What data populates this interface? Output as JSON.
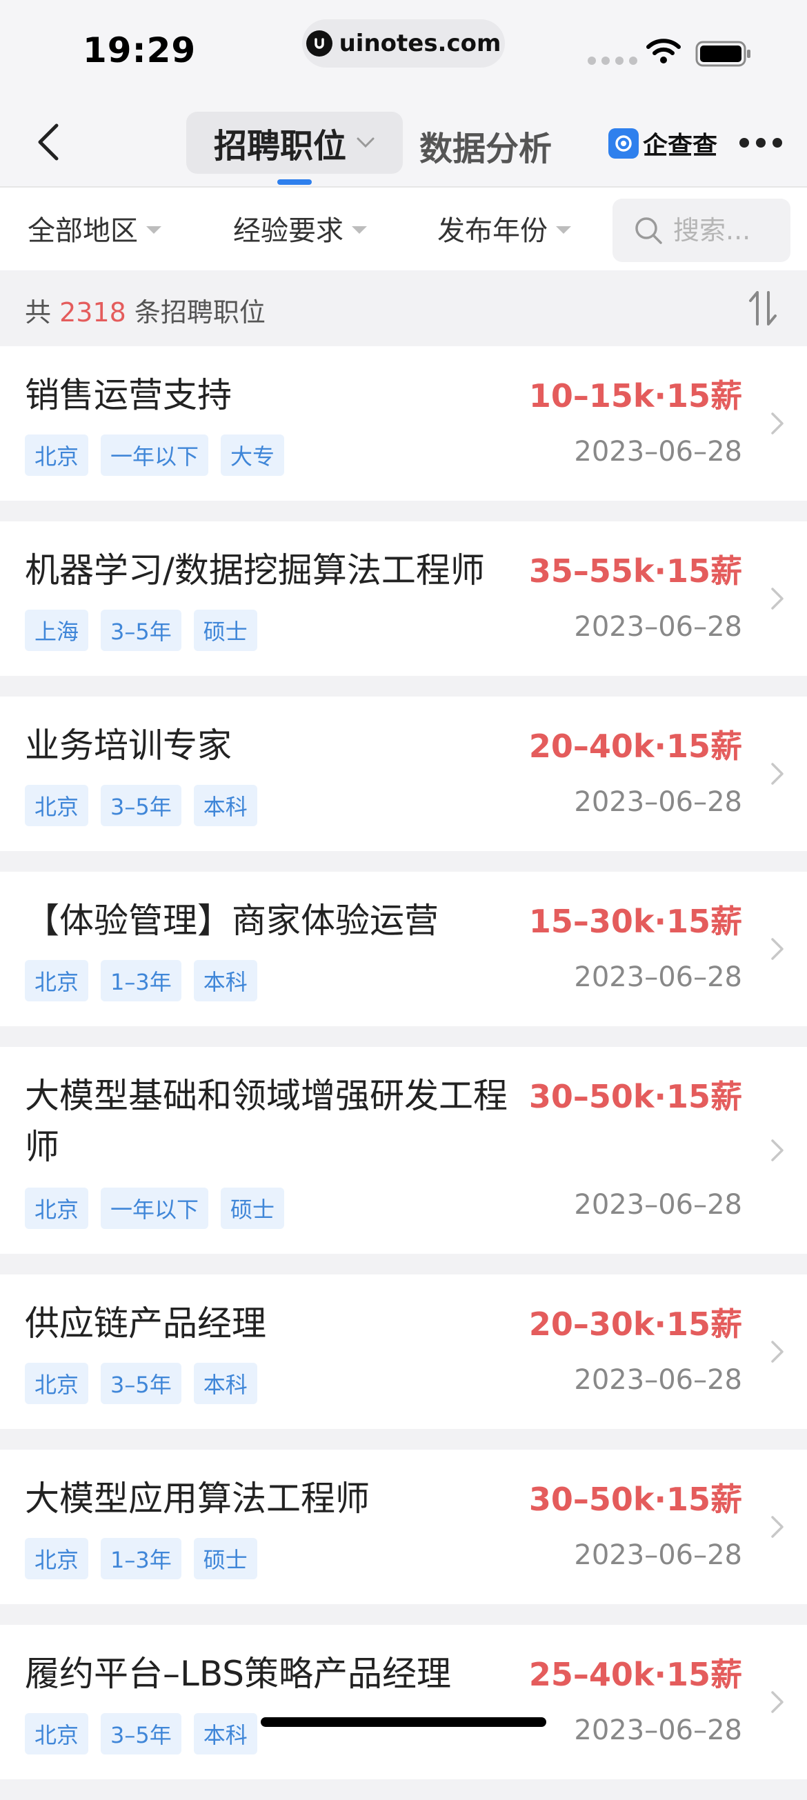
{
  "status_bar": {
    "time": "19:29",
    "url": "uinotes.com"
  },
  "nav": {
    "back_icon": "chevron-left-icon",
    "active_tab": "招聘职位",
    "tab_2": "数据分析",
    "brand": "企查查",
    "more_icon": "more-dots-icon"
  },
  "filters": {
    "region": "全部地区",
    "experience": "经验要求",
    "year": "发布年份",
    "search_placeholder": "搜索..."
  },
  "count": {
    "prefix": "共",
    "number": "2318",
    "suffix": "条招聘职位"
  },
  "colors": {
    "accent_blue": "#2f80ed",
    "salary_red": "#e45c5c",
    "tag_bg": "#e9f2fd",
    "tag_text": "#3f86d8"
  },
  "jobs": [
    {
      "title": "销售运营支持",
      "salary": "10–15k·15薪",
      "tags": [
        "北京",
        "一年以下",
        "大专"
      ],
      "date": "2023–06–28"
    },
    {
      "title": "机器学习/数据挖掘算法工程师",
      "salary": "35–55k·15薪",
      "tags": [
        "上海",
        "3–5年",
        "硕士"
      ],
      "date": "2023–06–28"
    },
    {
      "title": "业务培训专家",
      "salary": "20–40k·15薪",
      "tags": [
        "北京",
        "3–5年",
        "本科"
      ],
      "date": "2023–06–28"
    },
    {
      "title": "【体验管理】商家体验运营",
      "salary": "15–30k·15薪",
      "tags": [
        "北京",
        "1–3年",
        "本科"
      ],
      "date": "2023–06–28"
    },
    {
      "title": "大模型基础和领域增强研发工程师",
      "salary": "30–50k·15薪",
      "tags": [
        "北京",
        "一年以下",
        "硕士"
      ],
      "date": "2023–06–28"
    },
    {
      "title": "供应链产品经理",
      "salary": "20–30k·15薪",
      "tags": [
        "北京",
        "3–5年",
        "本科"
      ],
      "date": "2023–06–28"
    },
    {
      "title": "大模型应用算法工程师",
      "salary": "30–50k·15薪",
      "tags": [
        "北京",
        "1–3年",
        "硕士"
      ],
      "date": "2023–06–28"
    },
    {
      "title": "履约平台–LBS策略产品经理",
      "salary": "25–40k·15薪",
      "tags": [
        "北京",
        "3–5年",
        "本科"
      ],
      "date": "2023–06–28"
    }
  ]
}
